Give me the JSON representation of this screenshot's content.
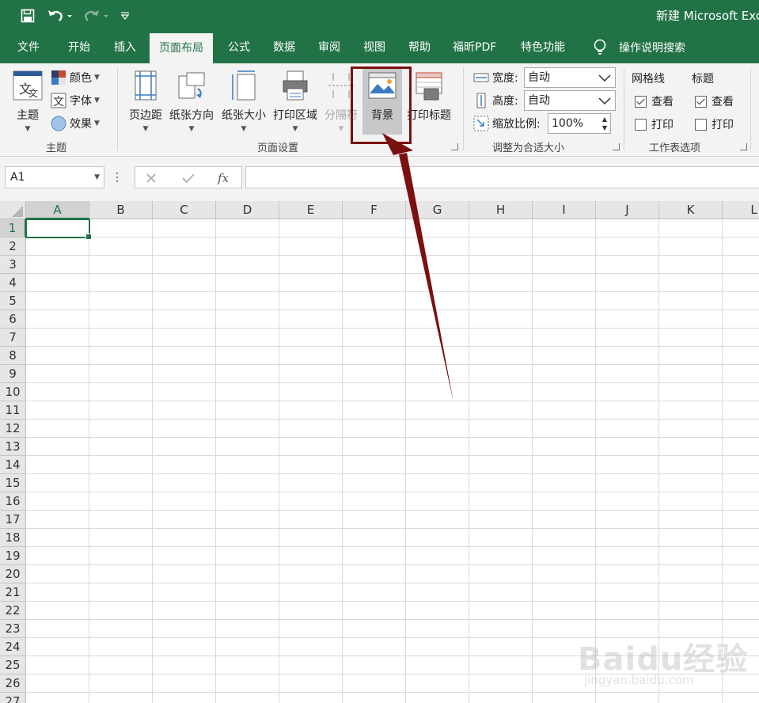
{
  "titlebar": {
    "title": "新建 Microsoft Excel"
  },
  "tabs": [
    {
      "label": "文件",
      "active": false
    },
    {
      "label": "开始",
      "active": false
    },
    {
      "label": "插入",
      "active": false
    },
    {
      "label": "页面布局",
      "active": true
    },
    {
      "label": "公式",
      "active": false
    },
    {
      "label": "数据",
      "active": false
    },
    {
      "label": "审阅",
      "active": false
    },
    {
      "label": "视图",
      "active": false
    },
    {
      "label": "帮助",
      "active": false
    },
    {
      "label": "福昕PDF",
      "active": false
    },
    {
      "label": "特色功能",
      "active": false
    }
  ],
  "tell_me": "操作说明搜索",
  "ribbon": {
    "theme": {
      "group_label": "主题",
      "themes_label": "主题",
      "colors_label": "颜色",
      "fonts_label": "字体",
      "effects_label": "效果",
      "theme_icon_text": "文"
    },
    "page_setup": {
      "group_label": "页面设置",
      "margins_label": "页边距",
      "orientation_label": "纸张方向",
      "size_label": "纸张大小",
      "print_area_label": "打印区域",
      "breaks_label": "分隔符",
      "background_label": "背景",
      "print_titles_label": "打印标题"
    },
    "scale_to_fit": {
      "group_label": "调整为合适大小",
      "width_label": "宽度:",
      "width_value": "自动",
      "height_label": "高度:",
      "height_value": "自动",
      "scale_label": "缩放比例:",
      "scale_value": "100%"
    },
    "sheet_options": {
      "group_label": "工作表选项",
      "gridlines_label": "网格线",
      "headings_label": "标题",
      "view_label": "查看",
      "print_label": "打印",
      "gridlines_view": true,
      "gridlines_print": false,
      "headings_view": true,
      "headings_print": false
    }
  },
  "formula_bar": {
    "name_box": "A1",
    "formula": ""
  },
  "sheet": {
    "columns": [
      "A",
      "B",
      "C",
      "D",
      "E",
      "F",
      "G",
      "H",
      "I",
      "J",
      "K",
      "L"
    ],
    "rows": [
      "1",
      "2",
      "3",
      "4",
      "5",
      "6",
      "7",
      "8",
      "9",
      "10",
      "11",
      "12",
      "13",
      "14",
      "15",
      "16",
      "17",
      "18",
      "19",
      "20",
      "21",
      "22",
      "23",
      "24",
      "25",
      "26",
      "27"
    ],
    "active_cell": "A1"
  },
  "watermark": {
    "brand": "Baidu经验",
    "url": "jingyan.baidu.com"
  },
  "colors": {
    "excel_green": "#217346",
    "callout": "#7a1010"
  }
}
